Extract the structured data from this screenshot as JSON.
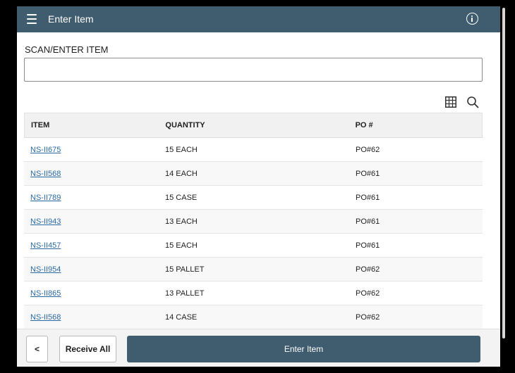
{
  "header": {
    "title": "Enter Item",
    "menu_icon": "hamburger-menu-icon",
    "info_icon": "info-icon",
    "color": "#3f5d6f"
  },
  "scan": {
    "label": "SCAN/ENTER ITEM",
    "value": "",
    "placeholder": ""
  },
  "toolbar": {
    "icons": [
      "grid-view-icon",
      "search-icon"
    ]
  },
  "table": {
    "columns": [
      "ITEM",
      "QUANTITY",
      "PO #"
    ],
    "rows": [
      {
        "item": "NS-II675",
        "quantity": "15 EACH",
        "po": "PO#62"
      },
      {
        "item": "NS-II568",
        "quantity": "14 EACH",
        "po": "PO#61"
      },
      {
        "item": "NS-II789",
        "quantity": "15 CASE",
        "po": "PO#61"
      },
      {
        "item": "NS-II943",
        "quantity": "13 EACH",
        "po": "PO#61"
      },
      {
        "item": "NS-II457",
        "quantity": "15 EACH",
        "po": "PO#61"
      },
      {
        "item": "NS-II954",
        "quantity": "15 PALLET",
        "po": "PO#62"
      },
      {
        "item": "NS-II865",
        "quantity": "13 PALLET",
        "po": "PO#62"
      },
      {
        "item": "NS-II568",
        "quantity": "14 CASE",
        "po": "PO#62"
      }
    ]
  },
  "footer": {
    "back_label": "<",
    "receive_all_label": "Receive All",
    "enter_item_label": "Enter Item"
  }
}
